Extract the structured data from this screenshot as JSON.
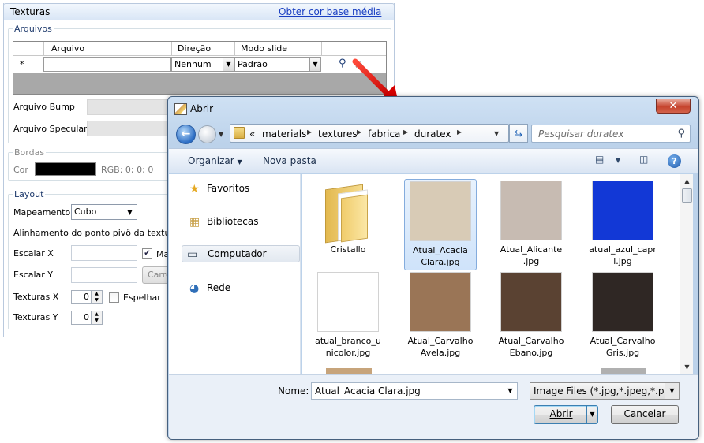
{
  "panel": {
    "title": "Texturas",
    "link": "Obter cor base média",
    "arquivos_group": "Arquivos",
    "grid": {
      "columns": [
        "Arquivo",
        "Direção",
        "Modo slide"
      ],
      "row_marker": "*",
      "direcao_value": "Nenhum",
      "modo_value": "Padrão"
    },
    "bump_label": "Arquivo Bump",
    "specular_label": "Arquivo Specular",
    "bordas_group": "Bordas",
    "cor_label": "Cor",
    "cor_color": "#000000",
    "rgb_text": "RGB: 0; 0; 0",
    "layout_group": "Layout",
    "mapeamento_label": "Mapeamento",
    "mapeamento_value": "Cubo",
    "alinhamento_label": "Alinhamento do ponto pivô da textura",
    "escalar_x_label": "Escalar X",
    "escalar_y_label": "Escalar Y",
    "ma_checkbox_text": "Ma",
    "carre_button_text": "Carre",
    "texturas_x_label": "Texturas X",
    "texturas_x_value": "0",
    "espelhar_label": "Espelhar",
    "texturas_y_label": "Texturas Y",
    "texturas_y_value": "0"
  },
  "dialog": {
    "title": "Abrir",
    "close_label": "✕",
    "breadcrumb": [
      "«",
      "materials",
      "textures",
      "fabrica",
      "duratex"
    ],
    "search_placeholder": "Pesquisar duratex",
    "toolbar": {
      "organize": "Organizar",
      "new_folder": "Nova pasta",
      "help": "?"
    },
    "nav": [
      {
        "label": "Favoritos",
        "icon": "star-icon"
      },
      {
        "label": "Bibliotecas",
        "icon": "library-icon"
      },
      {
        "label": "Computador",
        "icon": "computer-icon"
      },
      {
        "label": "Rede",
        "icon": "network-icon"
      }
    ],
    "files": [
      {
        "name": "Cristallo",
        "type": "folder",
        "color": "#e8c46a"
      },
      {
        "name": "Atual_Acacia Clara.jpg",
        "line1": "Atual_Acacia",
        "line2": "Clara.jpg",
        "color": "#d8cbb6",
        "selected": true
      },
      {
        "name": "Atual_Alicante.jpg",
        "line1": "Atual_Alicante",
        "line2": ".jpg",
        "color": "#c7bbb2"
      },
      {
        "name": "atual_azul_capri.jpg",
        "line1": "atual_azul_capr",
        "line2": "i.jpg",
        "color": "#1238d6"
      },
      {
        "name": "atual_branco_unicolor.jpg",
        "line1": "atual_branco_u",
        "line2": "nicolor.jpg",
        "color": "#ffffff"
      },
      {
        "name": "Atual_Carvalho Avela.jpg",
        "line1": "Atual_Carvalho",
        "line2": "Avela.jpg",
        "color": "#9a7556"
      },
      {
        "name": "Atual_Carvalho Ebano.jpg",
        "line1": "Atual_Carvalho",
        "line2": "Ebano.jpg",
        "color": "#5a4232"
      },
      {
        "name": "Atual_Carvalho Gris.jpg",
        "line1": "Atual_Carvalho",
        "line2": "Gris.jpg",
        "color": "#2f2724"
      }
    ],
    "filename_label": "Nome:",
    "filename_value": "Atual_Acacia Clara.jpg",
    "filter_value": "Image Files (*.jpg,*.jpeg,*.png,*",
    "open_button": "Abrir",
    "cancel_button": "Cancelar"
  }
}
